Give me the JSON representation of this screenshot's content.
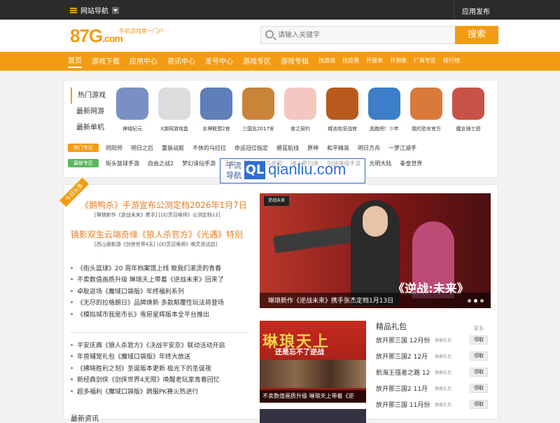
{
  "topbar": {
    "nav_label": "网站导航",
    "app_publish": "应用发布"
  },
  "logo": {
    "text": "87G",
    "com": ".com",
    "tagline": "手机游戏第一门户"
  },
  "search": {
    "placeholder": "请输入关键字",
    "button": "搜索"
  },
  "mainnav": [
    {
      "label": "首页",
      "active": true
    },
    {
      "label": "游戏下载"
    },
    {
      "label": "应用中心"
    },
    {
      "label": "资讯中心"
    },
    {
      "label": "发号中心"
    },
    {
      "label": "游戏专区"
    },
    {
      "label": "游戏专辑"
    },
    {
      "label": "找游戏",
      "small": true
    },
    {
      "label": "找应用",
      "small": true
    },
    {
      "label": "开服表",
      "small": true
    },
    {
      "label": "开测表",
      "small": true
    },
    {
      "label": "厂商专区",
      "small": true
    },
    {
      "label": "排行榜",
      "small": true
    }
  ],
  "tabs": [
    "热门游戏",
    "最新网游",
    "最新单机"
  ],
  "games": [
    {
      "name": "神域纪元",
      "color": "#7a8fc4"
    },
    {
      "name": "X游网游戏盒",
      "color": "#dcdcdc"
    },
    {
      "name": "女神联盟2官",
      "color": "#5e7fb8"
    },
    {
      "name": "三国志2017安",
      "color": "#c9843a"
    },
    {
      "name": "食之契约",
      "color": "#f2c7c0"
    },
    {
      "name": "城池攻坚战官",
      "color": "#b85a1e"
    },
    {
      "name": "逃跑吧！少年",
      "color": "#3c7fc8"
    },
    {
      "name": "我的恐龙官方",
      "color": "#d8793a"
    },
    {
      "name": "魔女骑士团",
      "color": "#c85248"
    }
  ],
  "hot_zone": {
    "tag": "热门专区",
    "color": "#f39c12",
    "links": [
      "阴阳师",
      "明日之后",
      "重装战姬",
      "不休的乌拉拉",
      "命运冠位指定",
      "碧蓝航线",
      "原神",
      "和平精英",
      "明日方舟",
      "一梦江湖手"
    ]
  },
  "new_zone": {
    "tag": "最新专区",
    "color": "#5cb85c",
    "links": [
      "街头篮球手游",
      "自由之战2",
      "梦幻诛仙手游",
      "王者",
      "3D",
      "剑与家园",
      "魂斗罗归来",
      "剑侠情缘手游",
      "光明大陆",
      "拳皇世界"
    ]
  },
  "watermark": {
    "line1": "千流",
    "line2": "导航",
    "badge": "QL",
    "site": "qianliu.com"
  },
  "ribbon": "今日头条",
  "headlines": [
    {
      "title": "《鹅鸭杀》手游宣布公测定档2026年1月7日",
      "sub": "[琳琅新作《逆战未来》携手] [《幻灵召唤师》公测定档12]"
    },
    {
      "title": "镜影双生云端奇缘《狼人杀官方》《光遇》特别",
      "sub": "[西山居新游《剑侠世界4无] [《幻灵召唤师》唤灵测试启]"
    }
  ],
  "news1": [
    "《街头篮球》20 周年档案馆上线 致我们滚烫的青春",
    "不卖数值画质升级 琳琅天上带着《逆战未来》回来了",
    "卓耿返场《魔域口袋版》年终福利系列",
    "《无尽的拉格朗日》品牌焕新 多款颠覆性玩法将登场",
    "《模拟城市我是市长》雪愿星辉版本全平台推出"
  ],
  "news2": [
    "平安庆典《狼人杀官方》《决战平安京》联动活动开启",
    "年兽辅宠礼包《魔域口袋版》年终大放送",
    "《拂晓胜利之刻》圣诞版本更新 极光下的圣诞夜",
    "新经典剑侠《剑侠世界4无限》唤醒老玩家青春回忆",
    "超多福利《魔域口袋版》跨服PK赛火热进行"
  ],
  "latest_title": "最新资讯",
  "banner": {
    "tag": "逆战未来",
    "big": "《逆战:未来》",
    "caption": "琳琅新作《逆战未来》携手张杰定档1月13日"
  },
  "thumb": {
    "t1": "琳琅天上",
    "t2": "还是忘不了逆战",
    "caption": "不卖数值画质升级 琳琅天上带着《逆"
  },
  "gifts": {
    "title": "精品礼包",
    "more": "更多",
    "items": [
      {
        "name": "放开那三国 12月份",
        "type": "独家礼包",
        "btn": "领取"
      },
      {
        "name": "放开那三国2 12月",
        "type": "独家礼包",
        "btn": "领取"
      },
      {
        "name": "航海王强者之路 12",
        "type": "独家礼包",
        "btn": "领取"
      },
      {
        "name": "放开那三国2 11月",
        "type": "独家礼包",
        "btn": "领取"
      },
      {
        "name": "放开那三国 11月份",
        "type": "独家礼包",
        "btn": "领取"
      }
    ]
  }
}
